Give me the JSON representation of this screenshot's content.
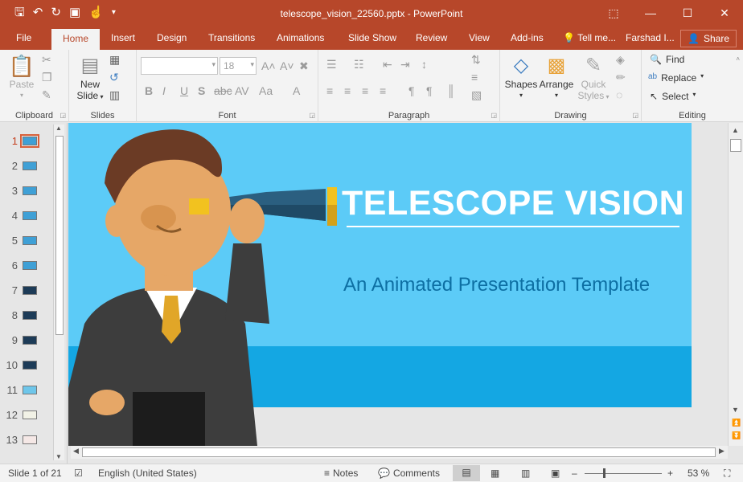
{
  "window": {
    "doc_title": "telescope_vision_22560.pptx - PowerPoint",
    "qat_icons": [
      "save-icon",
      "undo-icon",
      "redo-icon",
      "present-icon",
      "touch-icon",
      "customize-icon"
    ]
  },
  "tabs": [
    "File",
    "Home",
    "Insert",
    "Design",
    "Transitions",
    "Animations",
    "Slide Show",
    "Review",
    "View",
    "Add-ins"
  ],
  "tell_me": "Tell me...",
  "user": "Farshad I...",
  "share": "Share",
  "ribbon": {
    "clipboard": {
      "label": "Clipboard",
      "paste": "Paste"
    },
    "slides": {
      "label": "Slides",
      "new_slide_1": "New",
      "new_slide_2": "Slide"
    },
    "font": {
      "label": "Font",
      "font_size": "18"
    },
    "paragraph": {
      "label": "Paragraph"
    },
    "drawing": {
      "label": "Drawing",
      "shapes": "Shapes",
      "arrange": "Arrange",
      "quick_styles_1": "Quick",
      "quick_styles_2": "Styles"
    },
    "editing": {
      "label": "Editing",
      "find": "Find",
      "replace": "Replace",
      "select": "Select"
    }
  },
  "thumbnails": [
    "1",
    "2",
    "3",
    "4",
    "5",
    "6",
    "7",
    "8",
    "9",
    "10",
    "11",
    "12",
    "13"
  ],
  "slide": {
    "title": "TELESCOPE VISION",
    "subtitle": "An Animated Presentation Template"
  },
  "status": {
    "slide_of": "Slide 1 of 21",
    "language": "English (United States)",
    "notes": "Notes",
    "comments": "Comments",
    "zoom": "53 %"
  }
}
